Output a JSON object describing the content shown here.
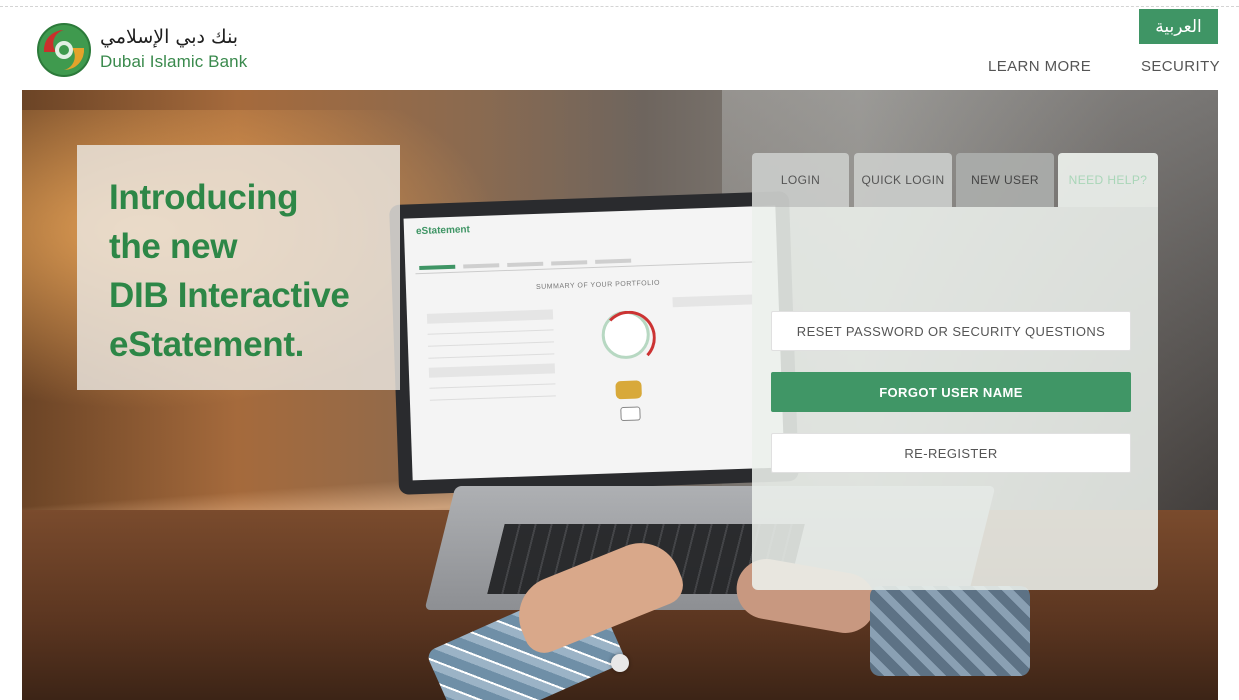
{
  "header": {
    "brand_arabic": "بنك دبي الإسلامي",
    "brand_english": "Dubai Islamic Bank",
    "language_button": "العربية",
    "nav": {
      "learn_more": "LEARN MORE",
      "security": "SECURITY"
    }
  },
  "hero": {
    "intro_lines": [
      "Introducing",
      "the new",
      "DIB Interactive",
      "eStatement."
    ],
    "laptop_screen": {
      "title": "eStatement",
      "summary_heading": "SUMMARY OF YOUR PORTFOLIO"
    }
  },
  "login_panel": {
    "tabs": {
      "login": "LOGIN",
      "quick_login": "QUICK LOGIN",
      "new_user": "NEW USER",
      "need_help": "NEED HELP?"
    },
    "active_tab": "need_help",
    "buttons": {
      "reset": "RESET PASSWORD OR SECURITY QUESTIONS",
      "forgot": "FORGOT USER NAME",
      "reregister": "RE-REGISTER"
    }
  },
  "colors": {
    "brand_green": "#409666",
    "headline_green": "#2d8747"
  },
  "icons": {
    "logo": "dib-logo-icon",
    "slide_indicator": "slide-dot-icon"
  }
}
